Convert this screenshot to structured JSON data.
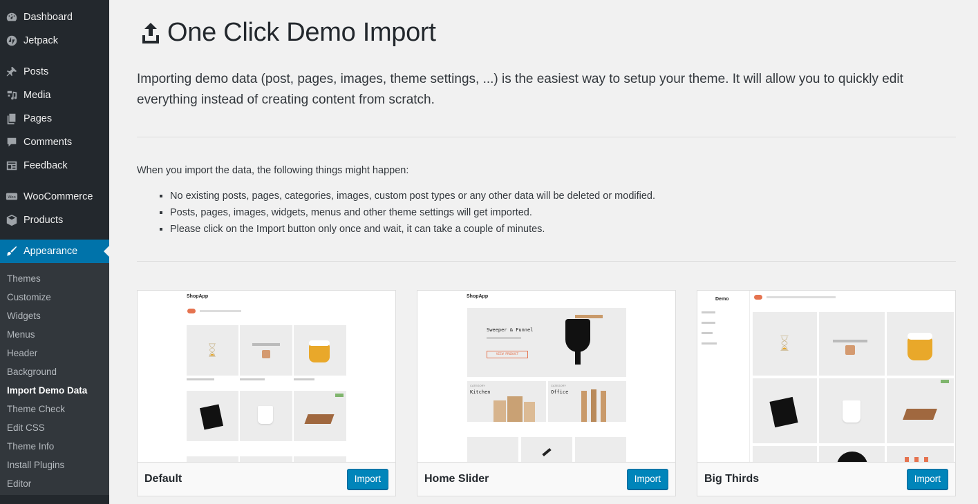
{
  "sidebar": {
    "items": [
      {
        "label": "Dashboard",
        "icon": "dashboard-icon"
      },
      {
        "label": "Jetpack",
        "icon": "jetpack-icon"
      },
      {
        "label": "Posts",
        "icon": "pin-icon"
      },
      {
        "label": "Media",
        "icon": "media-icon"
      },
      {
        "label": "Pages",
        "icon": "pages-icon"
      },
      {
        "label": "Comments",
        "icon": "comment-icon"
      },
      {
        "label": "Feedback",
        "icon": "feedback-icon"
      },
      {
        "label": "WooCommerce",
        "icon": "woo-icon"
      },
      {
        "label": "Products",
        "icon": "products-icon"
      },
      {
        "label": "Appearance",
        "icon": "brush-icon"
      }
    ],
    "submenu": [
      "Themes",
      "Customize",
      "Widgets",
      "Menus",
      "Header",
      "Background",
      "Import Demo Data",
      "Theme Check",
      "Edit CSS",
      "Theme Info",
      "Install Plugins",
      "Editor"
    ],
    "active_color": "#0073aa"
  },
  "page": {
    "title": "One Click Demo Import",
    "intro": "Importing demo data (post, pages, images, theme settings, ...) is the easiest way to setup your theme. It will allow you to quickly edit everything instead of creating content from scratch.",
    "notice": "When you import the data, the following things might happen:",
    "bullets": [
      "No existing posts, pages, categories, images, custom post types or any other data will be deleted or modified.",
      "Posts, pages, images, widgets, menus and other theme settings will get imported.",
      "Please click on the Import button only once and wait, it can take a couple of minutes."
    ]
  },
  "demos": [
    {
      "name": "Default",
      "button": "Import",
      "brand": "ShopApp"
    },
    {
      "name": "Home Slider",
      "button": "Import",
      "brand": "ShopApp",
      "hero_title": "Sweeper & Funnel",
      "hero_button": "VIEW PRODUCT",
      "cat1_small": "CATEGORY",
      "cat1": "Kitchen",
      "cat2_small": "CATEGORY",
      "cat2": "Office"
    },
    {
      "name": "Big Thirds",
      "button": "Import",
      "brand": "Demo"
    }
  ],
  "colors": {
    "button": "#0085ba",
    "accent": "#e5734f"
  }
}
